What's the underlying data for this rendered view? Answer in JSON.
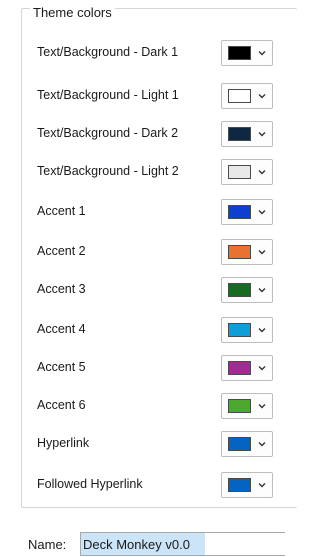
{
  "group": {
    "legend": "Theme colors"
  },
  "rows": [
    {
      "label": "Text/Background - Dark 1",
      "color": "#000000"
    },
    {
      "label": "Text/Background - Light 1",
      "color": "#ffffff"
    },
    {
      "label": "Text/Background - Dark 2",
      "color": "#0e2841"
    },
    {
      "label": "Text/Background - Light 2",
      "color": "#e8e8e8"
    },
    {
      "label": "Accent 1",
      "color": "#0f3fd0"
    },
    {
      "label": "Accent 2",
      "color": "#e97132"
    },
    {
      "label": "Accent 3",
      "color": "#196b24"
    },
    {
      "label": "Accent 4",
      "color": "#0f9ed5"
    },
    {
      "label": "Accent 5",
      "color": "#a02b93"
    },
    {
      "label": "Accent 6",
      "color": "#4ea72e"
    },
    {
      "label": "Hyperlink",
      "color": "#0563c1"
    },
    {
      "label": "Followed Hyperlink",
      "color": "#0563c1"
    }
  ],
  "name": {
    "label": "Name:",
    "value": "Deck Monkey v0.0"
  },
  "icons": {
    "dropdown": "chevron-down-icon"
  }
}
